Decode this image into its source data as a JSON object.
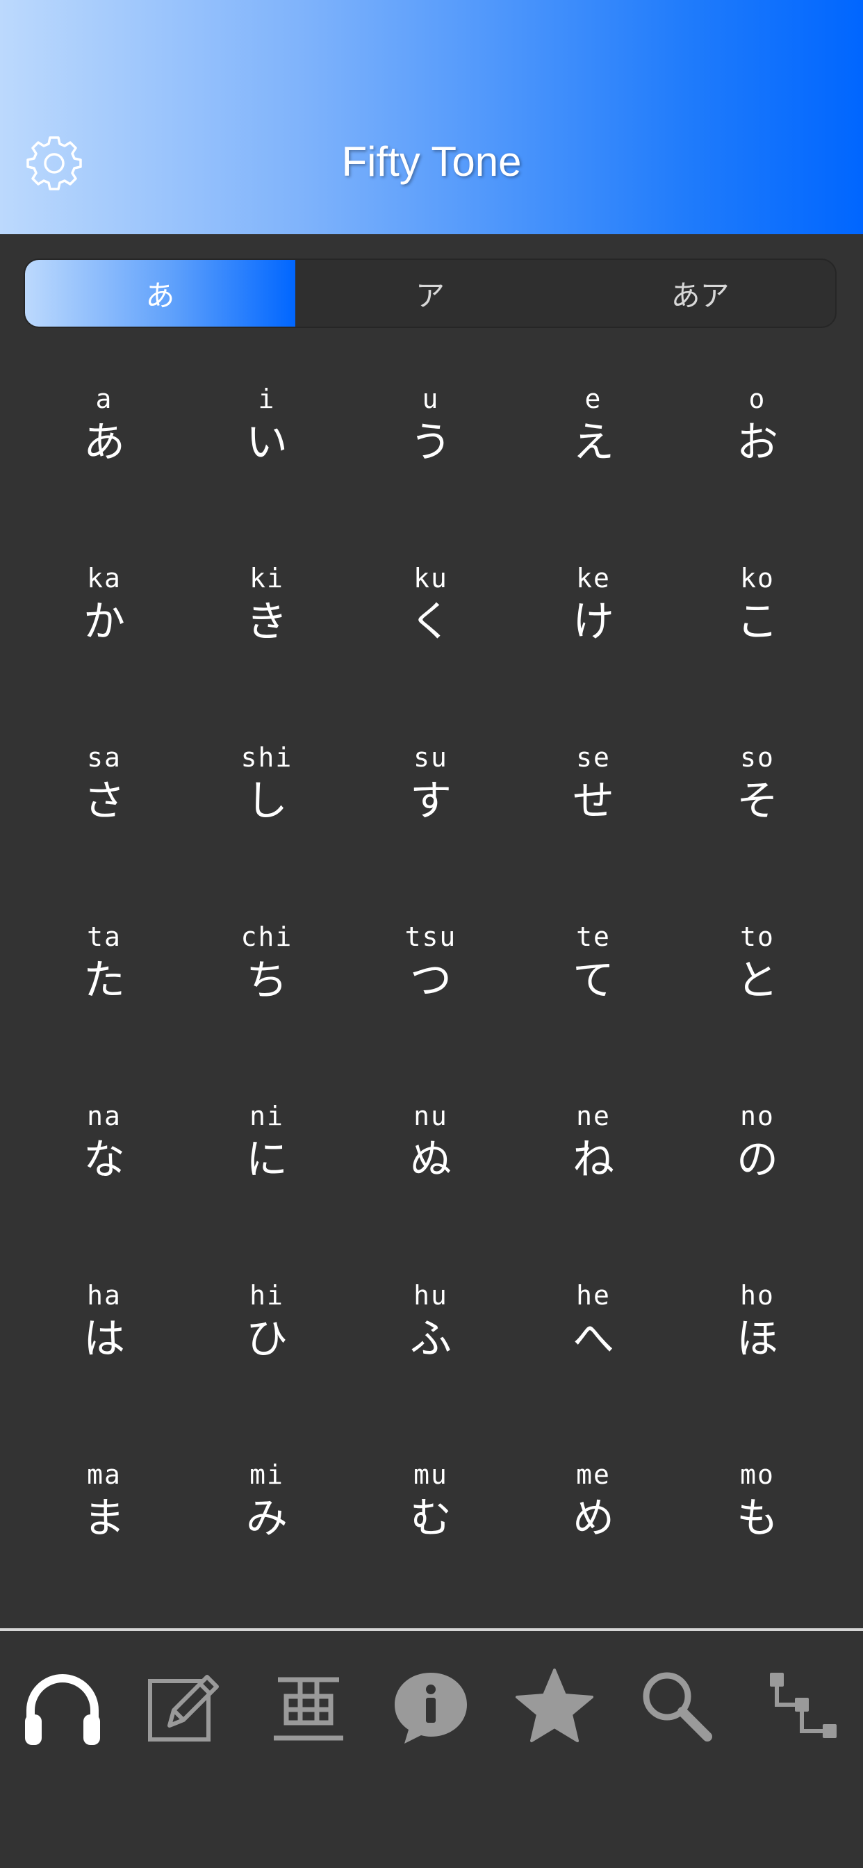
{
  "header": {
    "title": "Fifty Tone",
    "gradient_start": "#bcd9fd",
    "gradient_end": "#0066ff",
    "settings_icon": "gear-icon"
  },
  "segmented": {
    "options": [
      "あ",
      "ア",
      "あア"
    ],
    "selected_index": 0
  },
  "kana_rows": [
    [
      {
        "romaji": "a",
        "kana": "あ"
      },
      {
        "romaji": "i",
        "kana": "い"
      },
      {
        "romaji": "u",
        "kana": "う"
      },
      {
        "romaji": "e",
        "kana": "え"
      },
      {
        "romaji": "o",
        "kana": "お"
      }
    ],
    [
      {
        "romaji": "ka",
        "kana": "か"
      },
      {
        "romaji": "ki",
        "kana": "き"
      },
      {
        "romaji": "ku",
        "kana": "く"
      },
      {
        "romaji": "ke",
        "kana": "け"
      },
      {
        "romaji": "ko",
        "kana": "こ"
      }
    ],
    [
      {
        "romaji": "sa",
        "kana": "さ"
      },
      {
        "romaji": "shi",
        "kana": "し"
      },
      {
        "romaji": "su",
        "kana": "す"
      },
      {
        "romaji": "se",
        "kana": "せ"
      },
      {
        "romaji": "so",
        "kana": "そ"
      }
    ],
    [
      {
        "romaji": "ta",
        "kana": "た"
      },
      {
        "romaji": "chi",
        "kana": "ち"
      },
      {
        "romaji": "tsu",
        "kana": "つ"
      },
      {
        "romaji": "te",
        "kana": "て"
      },
      {
        "romaji": "to",
        "kana": "と"
      }
    ],
    [
      {
        "romaji": "na",
        "kana": "な"
      },
      {
        "romaji": "ni",
        "kana": "に"
      },
      {
        "romaji": "nu",
        "kana": "ぬ"
      },
      {
        "romaji": "ne",
        "kana": "ね"
      },
      {
        "romaji": "no",
        "kana": "の"
      }
    ],
    [
      {
        "romaji": "ha",
        "kana": "は"
      },
      {
        "romaji": "hi",
        "kana": "ひ"
      },
      {
        "romaji": "hu",
        "kana": "ふ"
      },
      {
        "romaji": "he",
        "kana": "へ"
      },
      {
        "romaji": "ho",
        "kana": "ほ"
      }
    ],
    [
      {
        "romaji": "ma",
        "kana": "ま"
      },
      {
        "romaji": "mi",
        "kana": "み"
      },
      {
        "romaji": "mu",
        "kana": "む"
      },
      {
        "romaji": "me",
        "kana": "め"
      },
      {
        "romaji": "mo",
        "kana": "も"
      }
    ]
  ],
  "tabbar": {
    "items": [
      {
        "icon": "headphones-icon",
        "active": true
      },
      {
        "icon": "edit-icon",
        "active": false
      },
      {
        "icon": "kanji-icon",
        "active": false
      },
      {
        "icon": "info-bubble-icon",
        "active": false
      },
      {
        "icon": "star-icon",
        "active": false
      },
      {
        "icon": "search-icon",
        "active": false
      },
      {
        "icon": "flow-icon",
        "active": false
      }
    ],
    "active_color": "#ffffff",
    "inactive_color": "#9a9a9a"
  }
}
